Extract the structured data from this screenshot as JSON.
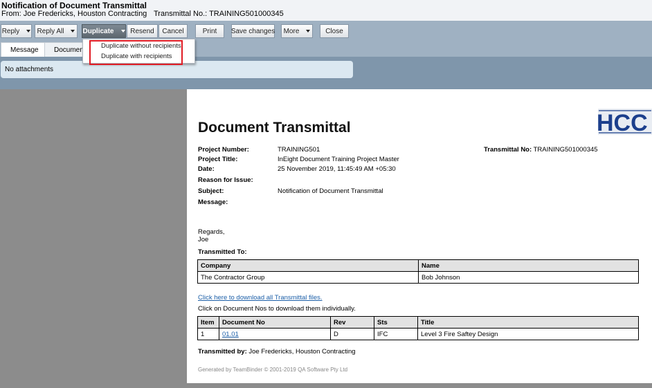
{
  "header": {
    "title": "Notification of Document Transmittal",
    "from": "From: Joe Fredericks, Houston Contracting",
    "transmittal_no": "Transmittal No.: TRAINING501000345"
  },
  "toolbar": {
    "reply": "Reply",
    "reply_all": "Reply All",
    "duplicate": "Duplicate",
    "resend": "Resend",
    "cancel": "Cancel",
    "print": "Print",
    "save_changes": "Save changes",
    "more": "More",
    "close": "Close"
  },
  "tabs": [
    "Message",
    "Documents"
  ],
  "attachments_text": "No attachments",
  "duplicate_menu": {
    "items": [
      "Duplicate without recipients",
      "Duplicate with recipients"
    ],
    "highlight_color": "#e01b24"
  },
  "document": {
    "logo_text": "HCC",
    "title": "Document Transmittal",
    "fields": [
      {
        "label": "Project Number:",
        "value": "TRAINING501"
      },
      {
        "label": "Project Title:",
        "value": "InEight Document Training Project Master"
      },
      {
        "label": "Date:",
        "value": "25 November 2019, 11:45:49 AM +05:30"
      },
      {
        "label": "Reason for Issue:",
        "value": ""
      },
      {
        "label": "Subject:",
        "value": "Notification of Document Transmittal"
      },
      {
        "label": "Message:",
        "value": ""
      }
    ],
    "transmittal_no_label": "Transmittal No:",
    "transmittal_no_value": "TRAINING501000345",
    "regards": "Regards,",
    "signature": "Joe",
    "transmitted_to_label": "Transmitted To:",
    "recipients_headers": [
      "Company",
      "Name"
    ],
    "recipients_rows": [
      [
        "The Contractor Group",
        "Bob Johnson"
      ]
    ],
    "download_all_link": "Click here to download all Transmittal files.",
    "download_hint": "Click on Document Nos to download them individually.",
    "docs_headers": [
      "Item",
      "Document No",
      "Rev",
      "Sts",
      "Title"
    ],
    "docs_rows": [
      [
        "1",
        "01.01",
        "D",
        "IFC",
        "Level 3 Fire Saftey Design"
      ]
    ],
    "transmitted_by_label": "Transmitted by:",
    "transmitted_by_value": "Joe Fredericks, Houston Contracting",
    "footer": "Generated by TeamBinder © 2001-2019 QA Software Pty Ltd"
  }
}
